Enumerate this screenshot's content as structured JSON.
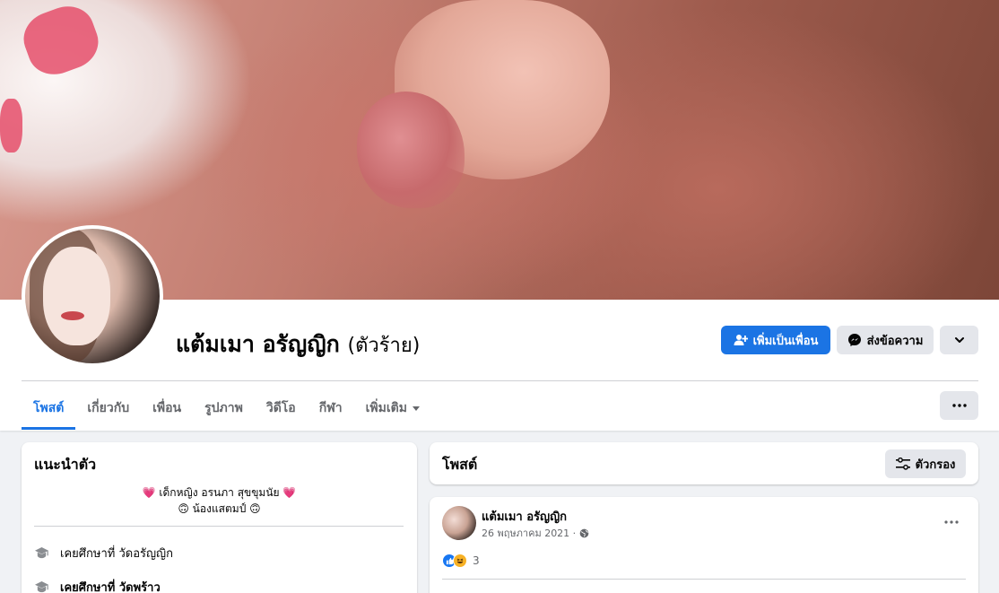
{
  "profile": {
    "name": "แต้มเมา อรัญญิก",
    "alternate_name": "(ตัวร้าย)"
  },
  "actions": {
    "add_friend_label": "เพิ่มเป็นเพื่อน",
    "message_label": "ส่งข้อความ",
    "more_icon": "chevron-down-icon",
    "primary_color": "#1b74e4"
  },
  "tabs": [
    {
      "label": "โพสต์",
      "active": true
    },
    {
      "label": "เกี่ยวกับ"
    },
    {
      "label": "เพื่อน"
    },
    {
      "label": "รูปภาพ"
    },
    {
      "label": "วิดีโอ"
    },
    {
      "label": "กีฬา"
    },
    {
      "label": "เพิ่มเติม"
    }
  ],
  "intro": {
    "title": "แนะนำตัว",
    "bio_line1": "💗 เด็กหญิง อรนภา สุขขุมนัย 💗",
    "bio_line2": "🙃 น้องแสตมป์ 🙃",
    "education": [
      {
        "text": "เคยศึกษาที่ วัดอรัญญิก",
        "icon": "graduation-cap-icon"
      },
      {
        "text": "เคยศึกษาที่ วัดพร้าว",
        "icon": "graduation-cap-icon"
      }
    ]
  },
  "posts_header": {
    "title": "โพสต์",
    "filter_label": "ตัวกรอง"
  },
  "post": {
    "author": "แต้มเมา อรัญญิก",
    "date": "26 พฤษภาคม 2021 ·",
    "privacy_icon": "globe-icon",
    "reaction_count": "3",
    "reactions": [
      "like",
      "haha"
    ]
  }
}
